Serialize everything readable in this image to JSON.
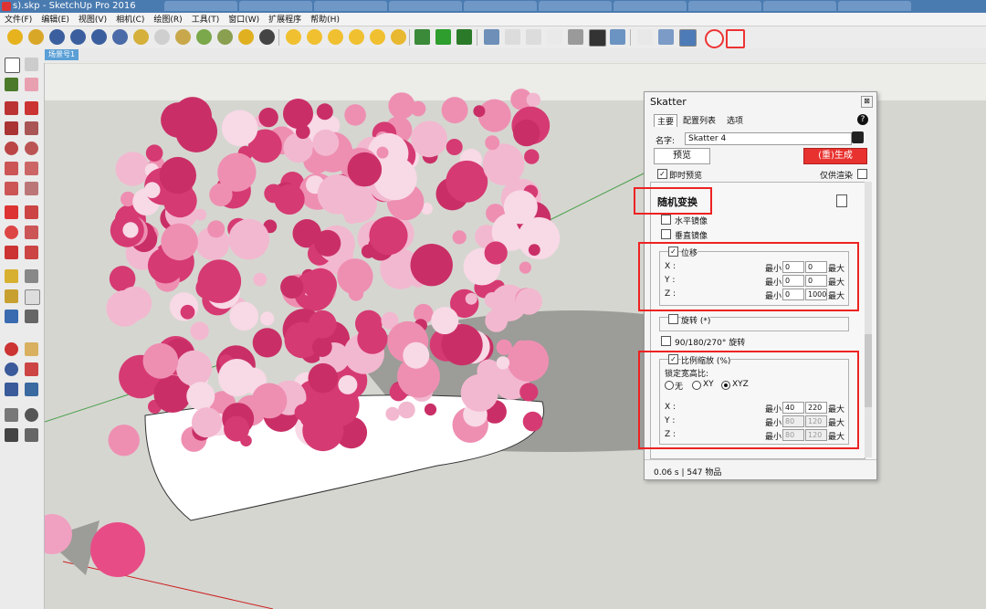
{
  "window": {
    "title": "s).skp - SketchUp Pro 2016"
  },
  "menu": [
    "文件(F)",
    "编辑(E)",
    "视图(V)",
    "相机(C)",
    "绘图(R)",
    "工具(T)",
    "窗口(W)",
    "扩展程序",
    "帮助(H)"
  ],
  "scene_tab": "场景号1",
  "skatter": {
    "title": "Skatter",
    "close": "⊠",
    "tabs": [
      "主要",
      "配置列表",
      "选项"
    ],
    "help": "?",
    "name_label": "名字:",
    "name_value": "Skatter 4",
    "preview_button": "预览",
    "generate_button": "(重)生成",
    "live_preview": "即时预览",
    "proxy_only": "仅供渲染",
    "section_title": "随机变换",
    "mirror_h": "水平镜像",
    "mirror_v": "垂直镜像",
    "offset": {
      "label": "位移",
      "rows": [
        {
          "axis": "X :",
          "min_label": "最小",
          "min": "0",
          "max": "0",
          "max_label": "最大"
        },
        {
          "axis": "Y :",
          "min_label": "最小",
          "min": "0",
          "max": "0",
          "max_label": "最大"
        },
        {
          "axis": "Z :",
          "min_label": "最小",
          "min": "0",
          "max": "1000",
          "max_label": "最大"
        }
      ]
    },
    "rotation": "旋转 (*)",
    "rotation_90": "90/180/270° 旋转",
    "scale": {
      "label": "比例缩放 (%)",
      "lock_label": "锁定宽高比:",
      "options": [
        "无",
        "XY",
        "XYZ"
      ],
      "selected": "XYZ",
      "rows": [
        {
          "axis": "X :",
          "min_label": "最小",
          "min": "40",
          "max": "220",
          "max_label": "最大"
        },
        {
          "axis": "Y :",
          "min_label": "最小",
          "min": "80",
          "max": "120",
          "max_label": "最大"
        },
        {
          "axis": "Z :",
          "min_label": "最小",
          "min": "80",
          "max": "120",
          "max_label": "最大"
        }
      ]
    },
    "status": "0.06 s | 547 物品"
  },
  "colors": {
    "accent_red": "#e8322f",
    "sphere_dark": "#d63a72",
    "sphere_mid": "#ee8fb2",
    "sphere_light": "#f8d9e6"
  }
}
